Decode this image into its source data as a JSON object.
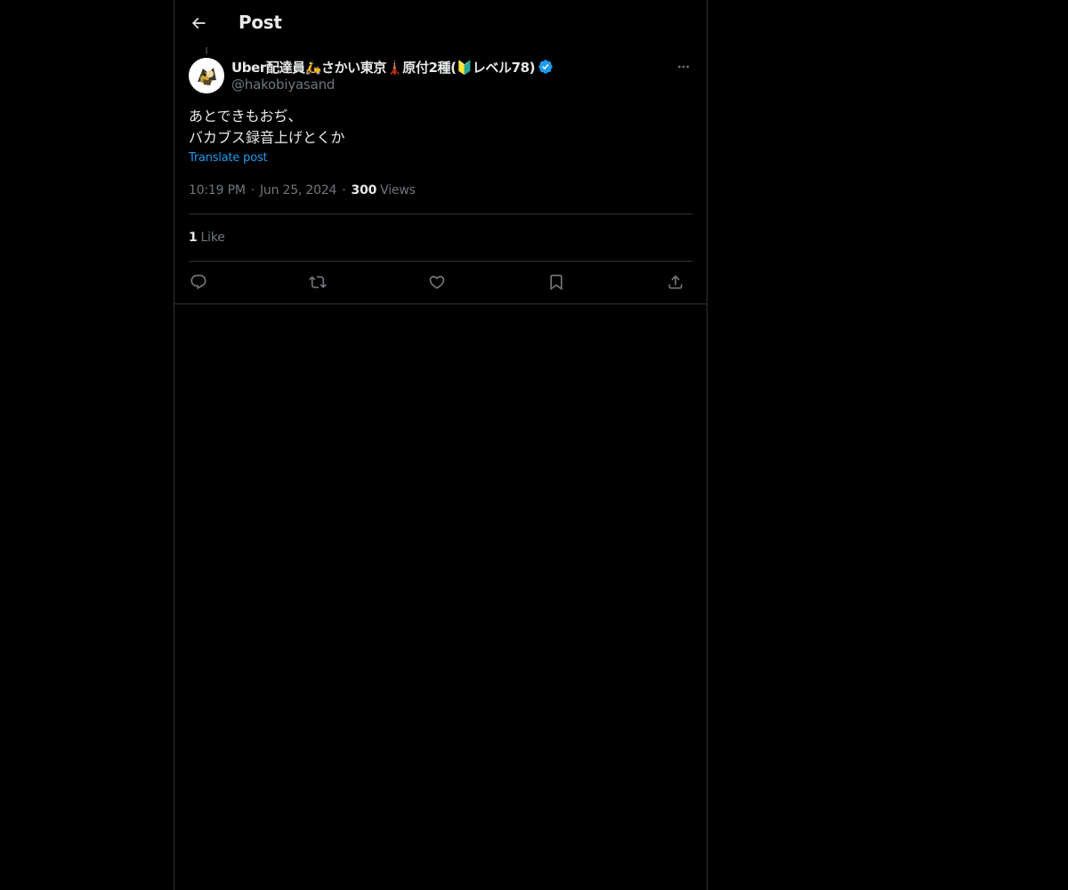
{
  "header": {
    "title": "Post"
  },
  "post": {
    "author": {
      "display_name": "Uber配達員🛵さかい東京🗼原付2種(🔰レベル78)",
      "handle": "@hakobiyasand",
      "verified": true
    },
    "text_lines": [
      "あとできもおぢ、",
      "バカブス録音上げとくか"
    ],
    "translate_label": "Translate post",
    "time": "10:19 PM",
    "date": "Jun 25, 2024",
    "views_count": "300",
    "views_label": "Views",
    "likes_count": "1",
    "likes_label": "Like"
  },
  "icons": {
    "back": "arrow-left-icon",
    "more": "more-horizontal-icon",
    "verified": "verified-badge-icon",
    "reply": "reply-icon",
    "repost": "repost-icon",
    "like": "heart-icon",
    "bookmark": "bookmark-icon",
    "share": "share-icon"
  },
  "colors": {
    "background": "#000000",
    "text": "#e7e9ea",
    "muted": "#71767b",
    "accent": "#1d9bf0",
    "border": "#2f3336"
  }
}
